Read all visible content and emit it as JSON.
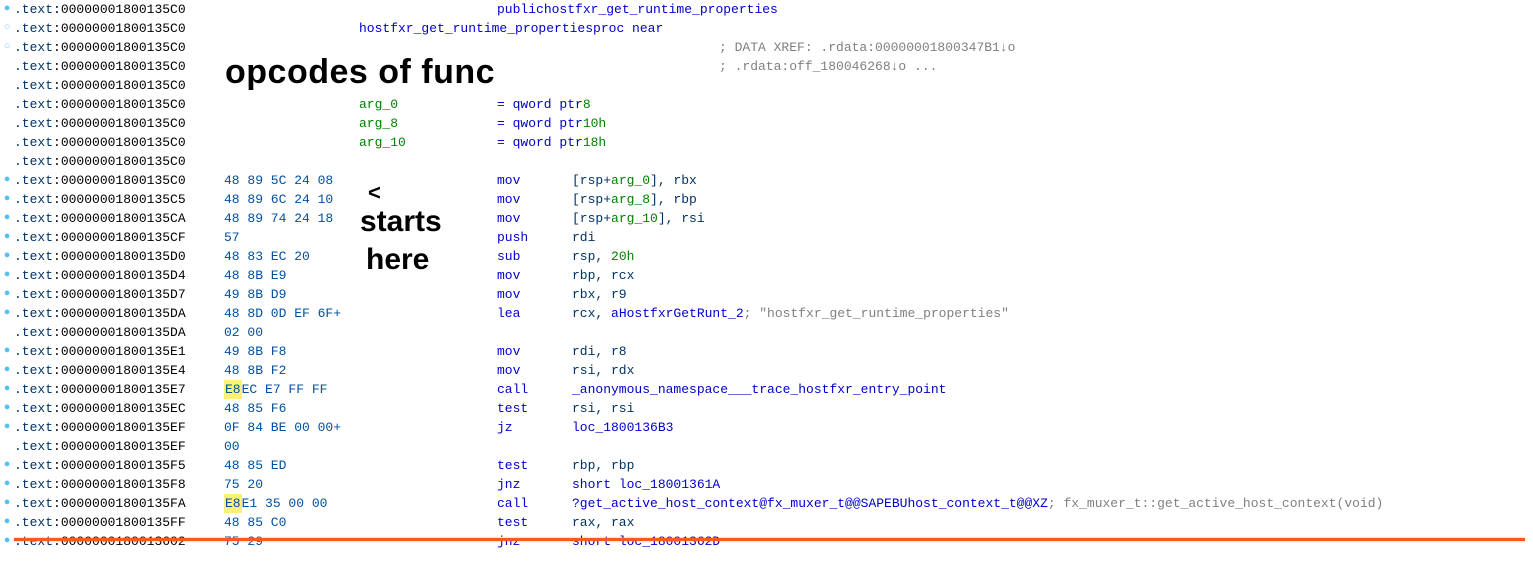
{
  "seg": ".text",
  "annotations": {
    "title": "opcodes of func",
    "arrow": "<",
    "starts": "starts",
    "here": "here"
  },
  "lines": [
    {
      "dot": "solid",
      "addr": "00000001800135C0",
      "bytes": "",
      "pad": "",
      "mnem": "",
      "op": "",
      "extra_k": "public",
      "extra_n": "hostfxr_get_runtime_properties"
    },
    {
      "dot": "open",
      "addr": "00000001800135C0",
      "bytes": "",
      "pad": "",
      "mnem": "",
      "op": "",
      "proc_n": "hostfxr_get_runtime_properties",
      "proc_k": "proc near"
    },
    {
      "dot": "open",
      "addr": "00000001800135C0",
      "bytes": "",
      "xref": "; DATA XREF: .rdata:00000001800347B1↓o"
    },
    {
      "dot": "",
      "addr": "00000001800135C0",
      "bytes": "",
      "xref": "; .rdata:off_180046268↓o ..."
    },
    {
      "dot": "",
      "addr": "00000001800135C0",
      "bytes": ""
    },
    {
      "dot": "",
      "addr": "00000001800135C0",
      "argname": "arg_0",
      "argdef": "= qword ptr  8"
    },
    {
      "dot": "",
      "addr": "00000001800135C0",
      "argname": "arg_8",
      "argdef": "= qword ptr  10h"
    },
    {
      "dot": "",
      "addr": "00000001800135C0",
      "argname": "arg_10",
      "argdef": "= qword ptr  18h"
    },
    {
      "dot": "",
      "addr": "00000001800135C0",
      "bytes": ""
    },
    {
      "dot": "solid",
      "addr": "00000001800135C0",
      "bytes": "48 89 5C 24 08",
      "mnem": "mov",
      "op_parts": [
        {
          "t": "[rsp+",
          "c": "reg"
        },
        {
          "t": "arg_0",
          "c": "num"
        },
        {
          "t": "], rbx",
          "c": "reg"
        }
      ]
    },
    {
      "dot": "solid",
      "addr": "00000001800135C5",
      "bytes": "48 89 6C 24 10",
      "mnem": "mov",
      "op_parts": [
        {
          "t": "[rsp+",
          "c": "reg"
        },
        {
          "t": "arg_8",
          "c": "num"
        },
        {
          "t": "], rbp",
          "c": "reg"
        }
      ]
    },
    {
      "dot": "solid",
      "addr": "00000001800135CA",
      "bytes": "48 89 74 24 18",
      "mnem": "mov",
      "op_parts": [
        {
          "t": "[rsp+",
          "c": "reg"
        },
        {
          "t": "arg_10",
          "c": "num"
        },
        {
          "t": "], rsi",
          "c": "reg"
        }
      ]
    },
    {
      "dot": "solid",
      "addr": "00000001800135CF",
      "bytes": "57",
      "mnem": "push",
      "op_parts": [
        {
          "t": "rdi",
          "c": "reg"
        }
      ]
    },
    {
      "dot": "solid",
      "addr": "00000001800135D0",
      "bytes": "48 83 EC 20",
      "mnem": "sub",
      "op_parts": [
        {
          "t": "rsp, ",
          "c": "reg"
        },
        {
          "t": "20h",
          "c": "num"
        }
      ]
    },
    {
      "dot": "solid",
      "addr": "00000001800135D4",
      "bytes": "48 8B E9",
      "mnem": "mov",
      "op_parts": [
        {
          "t": "rbp, rcx",
          "c": "reg"
        }
      ]
    },
    {
      "dot": "solid",
      "addr": "00000001800135D7",
      "bytes": "49 8B D9",
      "mnem": "mov",
      "op_parts": [
        {
          "t": "rbx, r9",
          "c": "reg"
        }
      ]
    },
    {
      "dot": "solid",
      "addr": "00000001800135DA",
      "bytes": "48 8D 0D EF 6F+",
      "mnem": "lea",
      "op_parts": [
        {
          "t": "rcx, ",
          "c": "reg"
        },
        {
          "t": "aHostfxrGetRunt_2",
          "c": "name"
        }
      ],
      "cmt": " ; \"hostfxr_get_runtime_properties\""
    },
    {
      "dot": "",
      "addr": "00000001800135DA",
      "bytes": "02 00"
    },
    {
      "dot": "solid",
      "addr": "00000001800135E1",
      "bytes": "49 8B F8",
      "mnem": "mov",
      "op_parts": [
        {
          "t": "rdi, r8",
          "c": "reg"
        }
      ]
    },
    {
      "dot": "solid",
      "addr": "00000001800135E4",
      "bytes": "48 8B F2",
      "mnem": "mov",
      "op_parts": [
        {
          "t": "rsi, rdx",
          "c": "reg"
        }
      ]
    },
    {
      "dot": "solid",
      "addr": "00000001800135E7",
      "bytes_hl": "E8",
      "bytes_rest": " EC E7 FF FF",
      "mnem": "call",
      "op_parts": [
        {
          "t": "_anonymous_namespace___trace_hostfxr_entry_point",
          "c": "name"
        }
      ]
    },
    {
      "dot": "solid",
      "addr": "00000001800135EC",
      "bytes": "48 85 F6",
      "mnem": "test",
      "op_parts": [
        {
          "t": "rsi, rsi",
          "c": "reg"
        }
      ]
    },
    {
      "dot": "solid",
      "addr": "00000001800135EF",
      "bytes": "0F 84 BE 00 00+",
      "mnem": "jz",
      "op_parts": [
        {
          "t": "loc_1800136B3",
          "c": "name"
        }
      ]
    },
    {
      "dot": "",
      "addr": "00000001800135EF",
      "bytes": "00"
    },
    {
      "dot": "solid",
      "addr": "00000001800135F5",
      "bytes": "48 85 ED",
      "mnem": "test",
      "op_parts": [
        {
          "t": "rbp, rbp",
          "c": "reg"
        }
      ]
    },
    {
      "dot": "solid",
      "addr": "00000001800135F8",
      "bytes": "75 20",
      "mnem": "jnz",
      "op_parts": [
        {
          "t": "short ",
          "c": "kw"
        },
        {
          "t": "loc_18001361A",
          "c": "name"
        }
      ]
    },
    {
      "dot": "solid",
      "addr": "00000001800135FA",
      "bytes_hl": "E8",
      "bytes_rest": " E1 35 00 00",
      "mnem": "call",
      "op_parts": [
        {
          "t": "?get_active_host_context@fx_muxer_t@@SAPEBUhost_context_t@@XZ",
          "c": "name"
        }
      ],
      "cmt": " ; fx_muxer_t::get_active_host_context(void)"
    },
    {
      "dot": "solid",
      "addr": "00000001800135FF",
      "bytes": "48 85 C0",
      "mnem": "test",
      "op_parts": [
        {
          "t": "rax, rax",
          "c": "reg"
        }
      ]
    },
    {
      "dot": "solid",
      "addr": "0000000180013602",
      "bytes": "75 29",
      "mnem": "jnz",
      "op_parts": [
        {
          "t": "short ",
          "c": "kw"
        },
        {
          "t": "loc_18001362D",
          "c": "name"
        }
      ]
    }
  ]
}
